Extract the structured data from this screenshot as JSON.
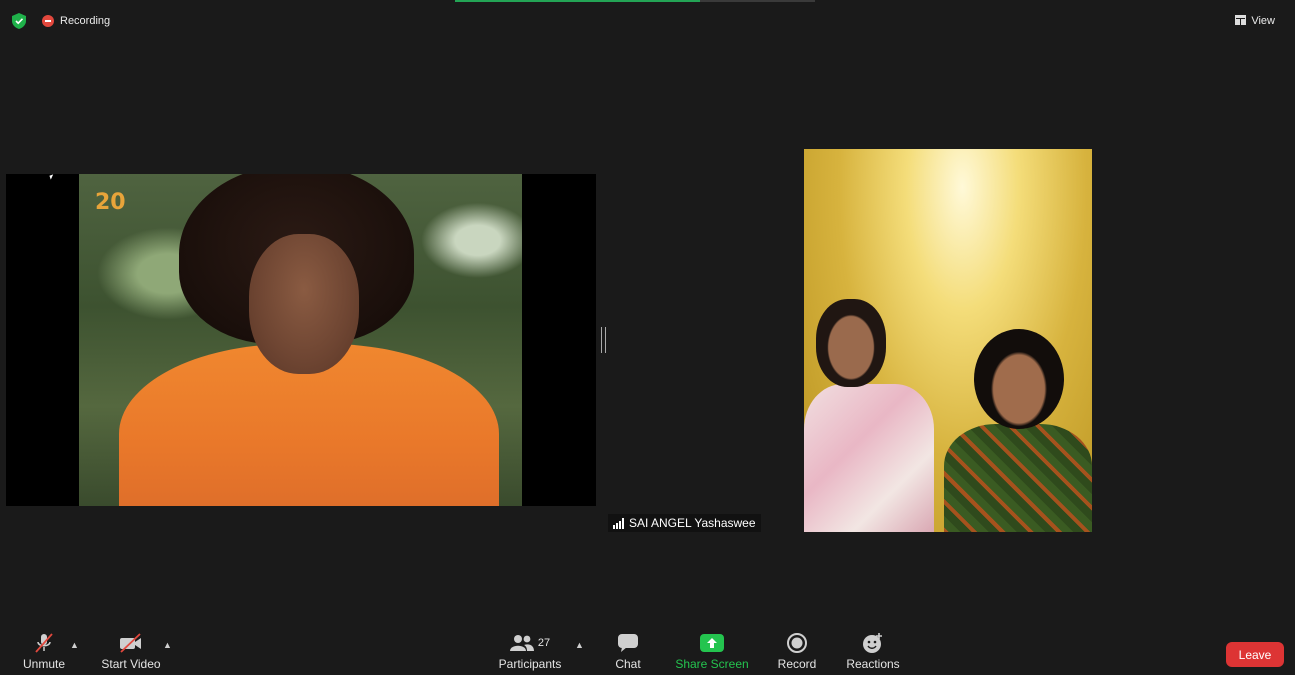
{
  "top": {
    "recording_label": "Recording",
    "view_label": "View"
  },
  "tiles": {
    "left_logo": "20",
    "right_participant_name": "SAI ANGEL Yashaswee"
  },
  "toolbar": {
    "unmute_label": "Unmute",
    "start_video_label": "Start Video",
    "participants_label": "Participants",
    "participants_count": "27",
    "chat_label": "Chat",
    "share_screen_label": "Share Screen",
    "record_label": "Record",
    "reactions_label": "Reactions",
    "leave_label": "Leave"
  },
  "colors": {
    "background": "#1a1a1a",
    "share_green": "#24c44f",
    "leave_red": "#dd3434",
    "record_red": "#e2483d"
  },
  "icons": [
    "shield-icon",
    "recording-icon",
    "view-icon",
    "signal-icon",
    "mic-muted-icon",
    "video-off-icon",
    "participants-icon",
    "chat-icon",
    "share-screen-icon",
    "record-icon",
    "reactions-icon"
  ]
}
